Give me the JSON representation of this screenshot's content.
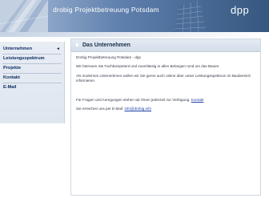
{
  "header": {
    "brand": "drobig Projektbetreuung Potsdam",
    "logo": "dpp",
    "colors": {
      "banner_dark": "#35577f",
      "banner_light": "#a9bed8"
    }
  },
  "nav": {
    "items": [
      {
        "label": "Unternehmen",
        "arrow": "◄"
      },
      {
        "label": "Leistungsspektrum",
        "arrow": ""
      },
      {
        "label": "Projekte",
        "arrow": ""
      },
      {
        "label": "Kontakt",
        "arrow": ""
      },
      {
        "label": "E-Mail",
        "arrow": ""
      }
    ]
  },
  "main": {
    "title": "Das Unternehmen",
    "p1": "Drobig Projektbetreuung Potsdam - dpp",
    "p2": "Wir betreuen Sie Fachkompetent und zuverlässig in allen Belangen rund um das Bauen.",
    "p3_line1": "Als modernes Unternehmen wollen wir Sie gerne auch online über unser Leistungsspektrum im Baubereich",
    "p3_line2": "informieren.",
    "p4_text": "Für Fragen und Anregungen stehen wir Ihnen jederzeit zur Verfügung.",
    "p4_link": "Kontakt",
    "p5_text": "Sie erreichen uns per E-Mail:",
    "p5_link": "info@drobig.info"
  }
}
